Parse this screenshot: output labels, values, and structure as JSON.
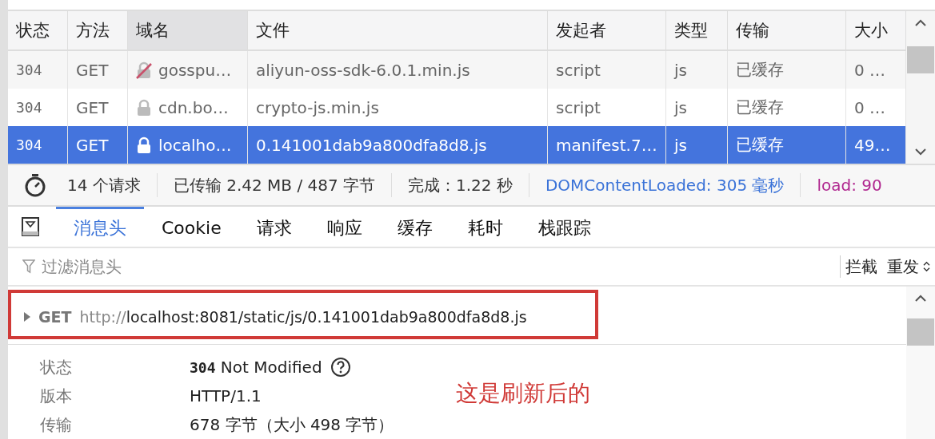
{
  "table": {
    "columns": [
      {
        "label": "状态",
        "sorted": false
      },
      {
        "label": "方法",
        "sorted": false
      },
      {
        "label": "域名",
        "sorted": true
      },
      {
        "label": "文件",
        "sorted": false
      },
      {
        "label": "发起者",
        "sorted": false
      },
      {
        "label": "类型",
        "sorted": false
      },
      {
        "label": "传输",
        "sorted": false
      },
      {
        "label": "大小",
        "sorted": false
      }
    ],
    "rows": [
      {
        "status": "304",
        "method": "GET",
        "secure": false,
        "domain": "gosspu…",
        "file": "aliyun-oss-sdk-6.0.1.min.js",
        "initiator": "script",
        "type": "js",
        "transferred": "已缓存",
        "size": "0 …",
        "selected": false
      },
      {
        "status": "304",
        "method": "GET",
        "secure": true,
        "domain": "cdn.bo…",
        "file": "crypto-js.min.js",
        "initiator": "script",
        "type": "js",
        "transferred": "已缓存",
        "size": "0 …",
        "selected": false
      },
      {
        "status": "304",
        "method": "GET",
        "secure": true,
        "domain": "localho…",
        "file": "0.141001dab9a800dfa8d8.js",
        "initiator": "manifest.7…",
        "type": "js",
        "transferred": "已缓存",
        "size": "49…",
        "selected": true
      }
    ]
  },
  "summary": {
    "requests": "14 个请求",
    "transferred": "已传输 2.42 MB / 487 字节",
    "finish": "完成：1.22 秒",
    "dom_content_loaded": "DOMContentLoaded: 305 毫秒",
    "load": "load: 90"
  },
  "tabs": [
    {
      "label": "消息头",
      "selected": true
    },
    {
      "label": "Cookie",
      "selected": false
    },
    {
      "label": "请求",
      "selected": false
    },
    {
      "label": "响应",
      "selected": false
    },
    {
      "label": "缓存",
      "selected": false
    },
    {
      "label": "耗时",
      "selected": false
    },
    {
      "label": "栈跟踪",
      "selected": false
    }
  ],
  "filter": {
    "placeholder": "过滤消息头"
  },
  "actions": [
    {
      "label": "拦截",
      "kind": "plain"
    },
    {
      "label": "重发",
      "kind": "dropdown"
    }
  ],
  "request": {
    "method": "GET",
    "url_scheme": "http://",
    "url_rest": "localhost:8081/static/js/0.141001dab9a800dfa8d8.js",
    "expanded": false
  },
  "details": [
    {
      "label": "状态",
      "code": "304",
      "value": "Not Modified",
      "kind": "status"
    },
    {
      "label": "版本",
      "value": "HTTP/1.1",
      "kind": "text"
    },
    {
      "label": "传输",
      "value": "678 字节（大小 498 字节）",
      "kind": "text"
    }
  ],
  "annotation": {
    "text": "这是刷新后的"
  }
}
